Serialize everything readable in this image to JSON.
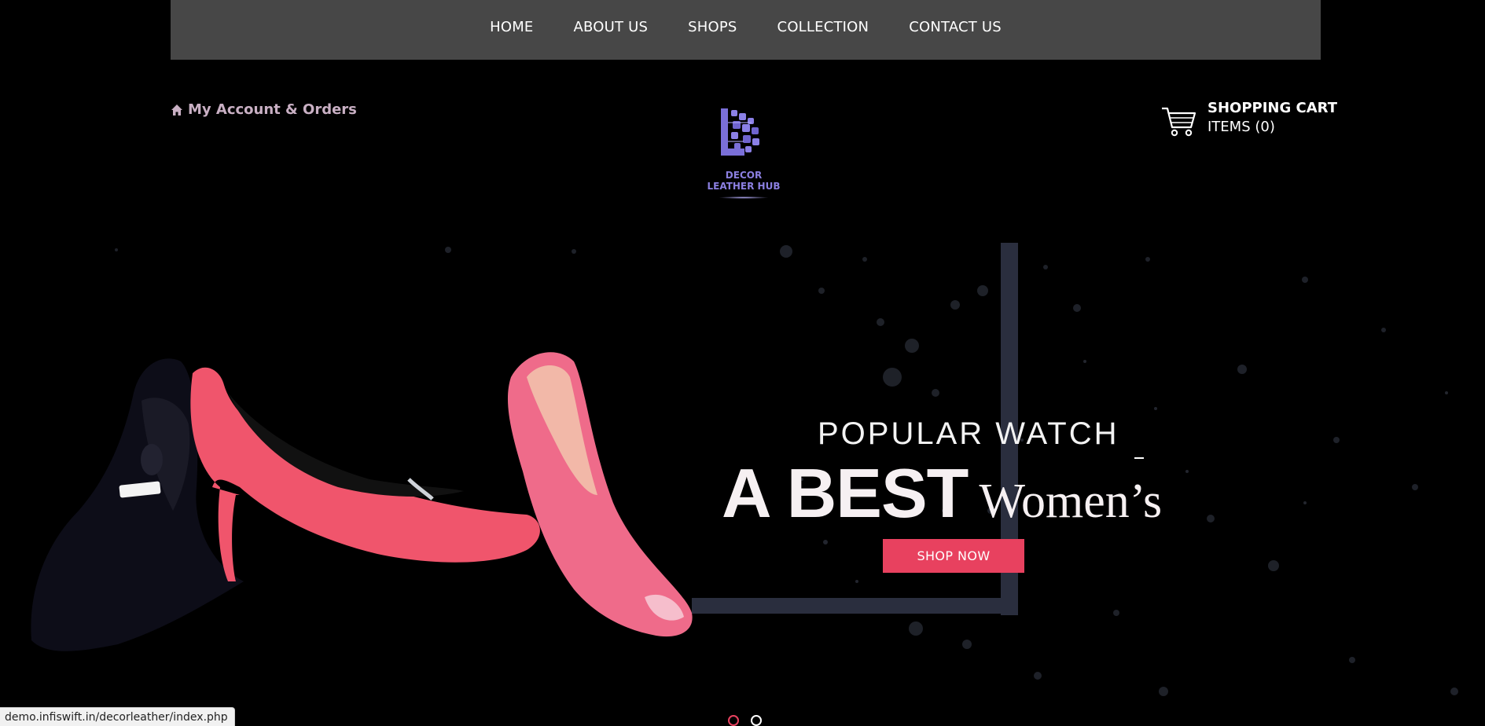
{
  "nav": {
    "items": [
      "HOME",
      "ABOUT US",
      "SHOPS",
      "COLLECTION",
      "CONTACT US"
    ]
  },
  "header": {
    "account_label": "My Account & Orders",
    "logo_line1": "DECOR",
    "logo_line2": "LEATHER HUB",
    "cart_title": "SHOPPING CART",
    "cart_items": "ITEMS (0)"
  },
  "hero": {
    "subtitle": "POPULAR WATCH",
    "title_bold": "A BEST",
    "title_serif": "Women’s",
    "button_label": "SHOP NOW",
    "slide_count": 2,
    "active_slide": 1
  },
  "status_bar": {
    "url": "demo.infiswift.in/decorleather/index.php"
  },
  "colors": {
    "nav_bg": "#474747",
    "accent": "#e8415f",
    "account_link": "#c9b0c4",
    "logo": "#8b7fe0",
    "frame": "#2a2e3e"
  },
  "icons": [
    "home-icon",
    "cart-icon",
    "logo-icon"
  ]
}
